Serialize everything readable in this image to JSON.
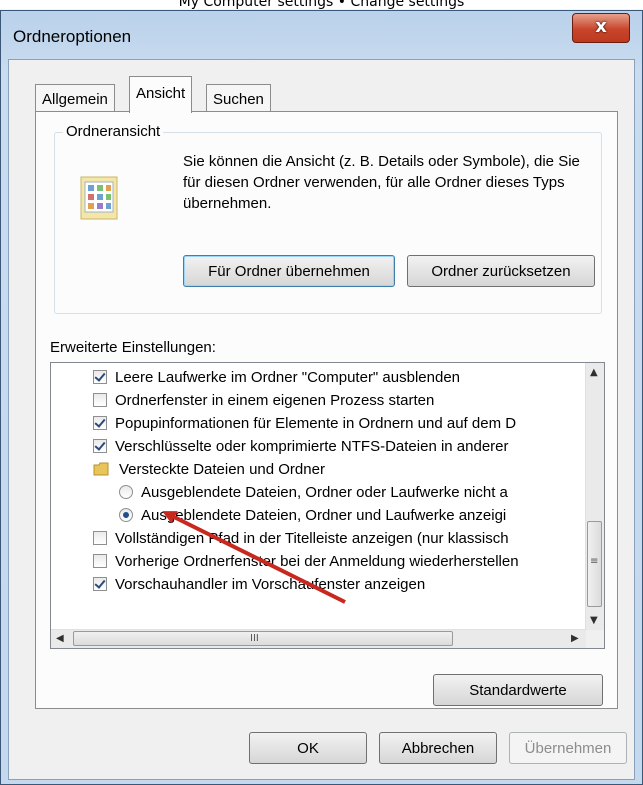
{
  "window": {
    "title": "Ordneroptionen",
    "close_glyph": "x"
  },
  "top_fragment": "My Computer settings • Change settings",
  "tabs": [
    {
      "label": "Allgemein",
      "active": false
    },
    {
      "label": "Ansicht",
      "active": true
    },
    {
      "label": "Suchen",
      "active": false
    }
  ],
  "folder_view": {
    "legend": "Ordneransicht",
    "icon": "folder-view-icon",
    "description": "Sie können die Ansicht (z. B. Details oder Symbole), die Sie für diesen Ordner verwenden, für alle Ordner dieses Typs übernehmen.",
    "apply_button": "Für Ordner übernehmen",
    "reset_button": "Ordner zurücksetzen"
  },
  "advanced": {
    "label": "Erweiterte Einstellungen:",
    "items": [
      {
        "type": "checkbox",
        "checked": true,
        "indent": 0,
        "label": "Leere Laufwerke im Ordner \"Computer\" ausblenden"
      },
      {
        "type": "checkbox",
        "checked": false,
        "indent": 0,
        "label": "Ordnerfenster in einem eigenen Prozess starten"
      },
      {
        "type": "checkbox",
        "checked": true,
        "indent": 0,
        "label": "Popupinformationen für Elemente in Ordnern und auf dem D"
      },
      {
        "type": "checkbox",
        "checked": true,
        "indent": 0,
        "label": "Verschlüsselte oder komprimierte NTFS-Dateien in anderer"
      },
      {
        "type": "folder",
        "checked": false,
        "indent": 0,
        "label": "Versteckte Dateien und Ordner"
      },
      {
        "type": "radio",
        "checked": false,
        "indent": 1,
        "label": "Ausgeblendete Dateien, Ordner oder Laufwerke nicht a"
      },
      {
        "type": "radio",
        "checked": true,
        "indent": 1,
        "label": "Ausgeblendete Dateien, Ordner und Laufwerke anzeigi"
      },
      {
        "type": "checkbox",
        "checked": false,
        "indent": 0,
        "label": "Vollständigen Pfad in der Titelleiste anzeigen (nur klassisch"
      },
      {
        "type": "checkbox",
        "checked": false,
        "indent": 0,
        "label": "Vorherige Ordnerfenster bei der Anmeldung wiederherstellen"
      },
      {
        "type": "checkbox",
        "checked": true,
        "indent": 0,
        "label": "Vorschauhandler im Vorschaufenster anzeigen"
      }
    ],
    "defaults_button": "Standardwerte"
  },
  "scrollbar": {
    "up": "▲",
    "down": "▼",
    "left": "◀",
    "right": "▶",
    "vgrip": "≡",
    "hgrip": "III"
  },
  "footer": {
    "ok": "OK",
    "cancel": "Abbrechen",
    "apply": "Übernehmen"
  },
  "colors": {
    "annotation_arrow": "#c8281e"
  }
}
